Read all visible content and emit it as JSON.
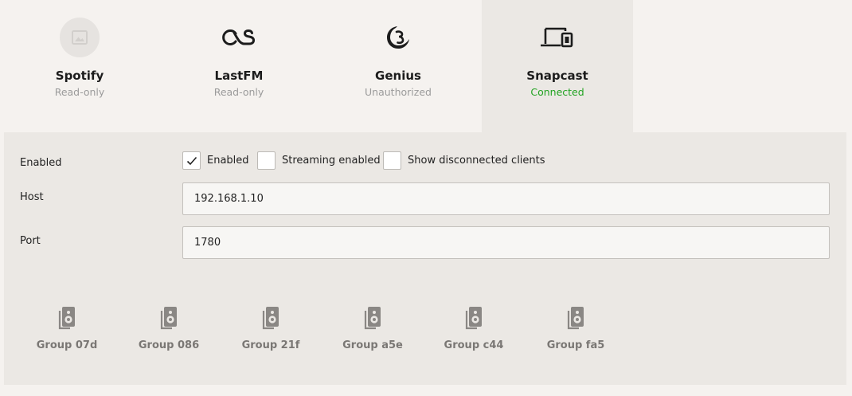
{
  "services": [
    {
      "name": "Spotify",
      "status": "Read-only",
      "icon": "image-placeholder-icon"
    },
    {
      "name": "LastFM",
      "status": "Read-only",
      "icon": "lastfm-icon"
    },
    {
      "name": "Genius",
      "status": "Unauthorized",
      "icon": "genius-icon"
    },
    {
      "name": "Snapcast",
      "status": "Connected",
      "icon": "devices-icon",
      "active": true
    }
  ],
  "settings": {
    "enabled_label": "Enabled",
    "checkboxes": [
      {
        "label": "Enabled",
        "checked": true
      },
      {
        "label": "Streaming enabled",
        "checked": false
      },
      {
        "label": "Show disconnected clients",
        "checked": false
      }
    ],
    "host_label": "Host",
    "host_value": "192.168.1.10",
    "port_label": "Port",
    "port_value": "1780"
  },
  "groups": [
    {
      "label": "Group 07d",
      "icon": "speaker-icon"
    },
    {
      "label": "Group 086",
      "icon": "speaker-icon"
    },
    {
      "label": "Group 21f",
      "icon": "speaker-icon"
    },
    {
      "label": "Group a5e",
      "icon": "speaker-icon"
    },
    {
      "label": "Group c44",
      "icon": "speaker-icon"
    },
    {
      "label": "Group fa5",
      "icon": "speaker-icon"
    }
  ],
  "colors": {
    "connected": "#22a322",
    "muted_text": "#9b9b9b",
    "active_tab_bg": "#ebe8e4",
    "page_bg": "#f5f2ef"
  }
}
